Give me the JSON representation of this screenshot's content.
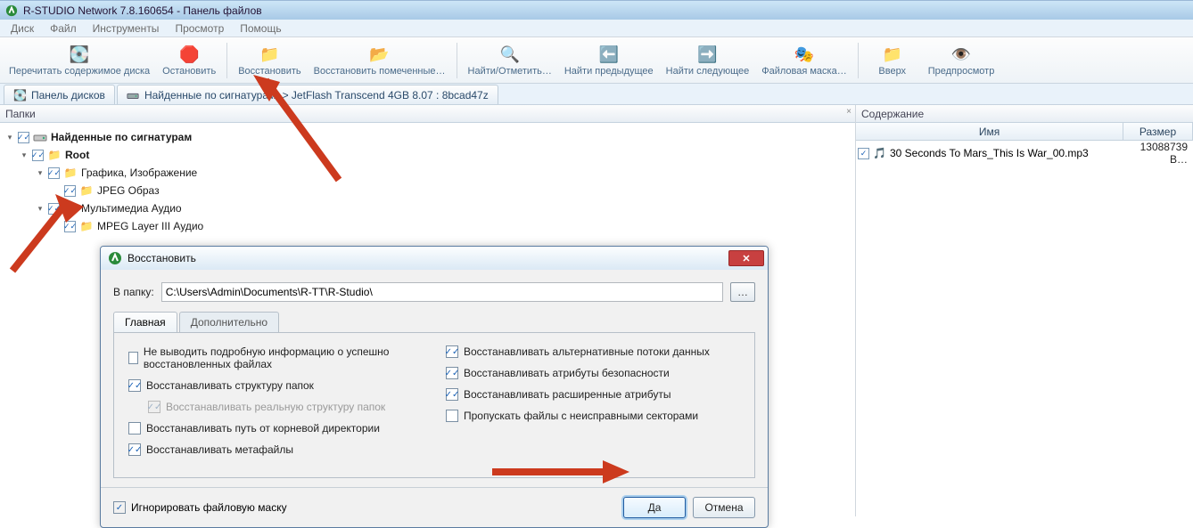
{
  "window": {
    "title": "R-STUDIO Network 7.8.160654 - Панель файлов"
  },
  "menu": {
    "items": [
      "Диск",
      "Файл",
      "Инструменты",
      "Просмотр",
      "Помощь"
    ]
  },
  "toolbar": {
    "reread": {
      "label": "Перечитать содержимое диска"
    },
    "stop": {
      "label": "Остановить"
    },
    "recover": {
      "label": "Восстановить"
    },
    "recover_marked": {
      "label": "Восстановить помеченные…"
    },
    "find": {
      "label": "Найти/Отметить…"
    },
    "find_prev": {
      "label": "Найти предыдущее"
    },
    "find_next": {
      "label": "Найти следующее"
    },
    "file_mask": {
      "label": "Файловая маска…"
    },
    "up": {
      "label": "Вверх"
    },
    "preview": {
      "label": "Предпросмотр"
    }
  },
  "tabs": {
    "disks": {
      "label": "Панель дисков"
    },
    "signature": {
      "label": "Найденные по сигнатурам -> JetFlash Transcend 4GB 8.07 : 8bcad47z"
    }
  },
  "left": {
    "header": "Папки",
    "tree": {
      "root": "Найденные по сигнатурам",
      "rootnode": "Root",
      "graphics": "Графика, Изображение",
      "jpeg": "JPEG Образ",
      "multimedia": "Мультимедиа Аудио",
      "mpeg": "MPEG Layer III Аудио"
    }
  },
  "right": {
    "header": "Содержание",
    "col_name": "Имя",
    "col_size": "Размер",
    "file": {
      "name": "30 Seconds To Mars_This Is War_00.mp3",
      "size": "13088739 B…"
    }
  },
  "dialog": {
    "title": "Восстановить",
    "path_label": "В папку:",
    "path_value": "C:\\Users\\Admin\\Documents\\R-TT\\R-Studio\\",
    "browse": "…",
    "tab_main": "Главная",
    "tab_extra": "Дополнительно",
    "opts": {
      "no_report": "Не выводить подробную информацию о успешно восстановленных файлах",
      "folder_struct": "Восстанавливать структуру папок",
      "real_folder": "Восстанавливать реальную структуру папок",
      "root_path": "Восстанавливать путь от корневой директории",
      "metafiles": "Восстанавливать метафайлы",
      "alt_streams": "Восстанавливать альтернативные потоки данных",
      "sec_attrs": "Восстанавливать атрибуты безопасности",
      "ext_attrs": "Восстанавливать расширенные атрибуты",
      "skip_bad": "Пропускать файлы с неисправными секторами"
    },
    "ignore_mask": "Игнорировать файловую маску",
    "ok": "Да",
    "cancel": "Отмена"
  }
}
